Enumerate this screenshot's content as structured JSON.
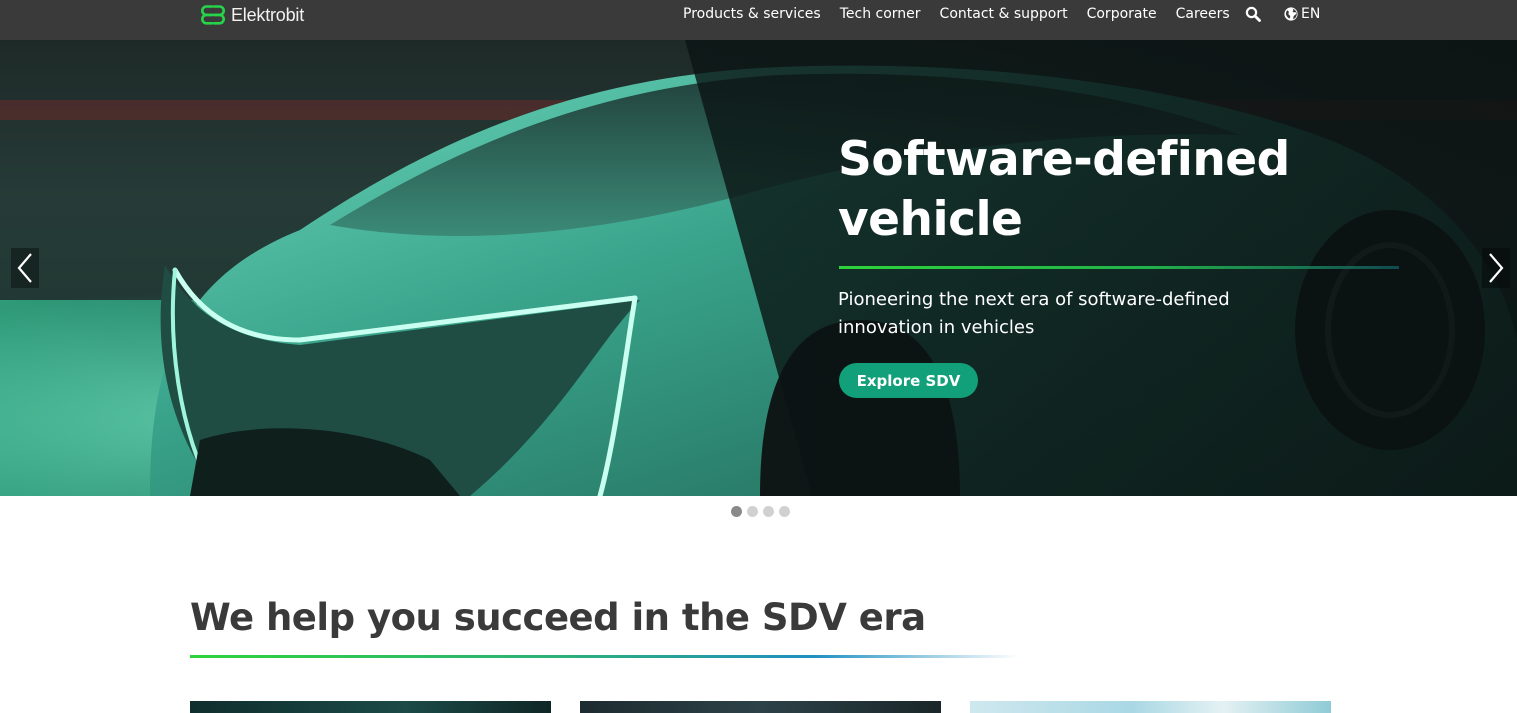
{
  "header": {
    "brand": "Elektrobit",
    "nav": [
      {
        "label": "Products & services"
      },
      {
        "label": "Tech corner"
      },
      {
        "label": "Contact & support"
      },
      {
        "label": "Corporate"
      },
      {
        "label": "Careers"
      }
    ],
    "search_icon": "search-icon",
    "language": {
      "icon": "globe-icon",
      "label": "EN"
    }
  },
  "hero": {
    "title": "Software-defined vehicle",
    "subtitle": "Pioneering the next era of software-defined innovation in vehicles",
    "cta_label": "Explore SDV",
    "prev_icon": "chevron-left-icon",
    "next_icon": "chevron-right-icon",
    "slide_count": 4,
    "active_slide": 1
  },
  "section": {
    "title": "We help you succeed in the SDV era",
    "cards_visible": 3
  },
  "colors": {
    "topbar": "#3a3a3a",
    "brand_green": "#2fd33b",
    "cta": "#12a07a",
    "heading": "#3a3a3a"
  }
}
